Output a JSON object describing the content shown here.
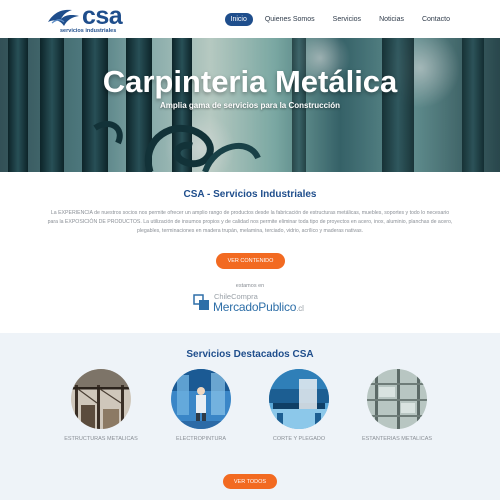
{
  "header": {
    "logo_text": "csa",
    "logo_sub": "servicios industriales",
    "nav": [
      {
        "label": "Inicio",
        "active": true
      },
      {
        "label": "Quienes Somos",
        "active": false
      },
      {
        "label": "Servicios",
        "active": false
      },
      {
        "label": "Noticias",
        "active": false
      },
      {
        "label": "Contacto",
        "active": false
      }
    ]
  },
  "hero": {
    "title": "Carpinteria Metálica",
    "subtitle": "Amplia gama de servicios para la Construcción"
  },
  "about": {
    "title": "CSA - Servicios Industriales",
    "text": "La EXPERIENCIA de nuestros socios nos permite ofrecer un amplio rango de productos desde la fabricación de estructuras metálicas, muebles, soportes y todo lo necesario para la EXPOSICIÓN DE PRODUCTOS. La utilización de insumos propios y de calidad nos permite eliminar toda tipo de proyectos en acero, inox, aluminio, planchas de acero, plegables, terminaciones en madera trupán, melamina, terciado, vidrio, acrílico y maderas nativas.",
    "button_label": "VER CONTENIDO",
    "listed_label": "estamos en",
    "mp_small": "ChileCompra",
    "mp_big": "MercadoPublico",
    "mp_suffix": ".cl"
  },
  "services": {
    "title": "Servicios Destacados CSA",
    "items": [
      {
        "label": "ESTRUCTURAS METALICAS",
        "icon": "steel-structure-photo"
      },
      {
        "label": "ELECTROPINTURA",
        "icon": "electropainting-photo"
      },
      {
        "label": "CORTE Y PLEGADO",
        "icon": "cutting-bending-photo"
      },
      {
        "label": "ESTANTERIAS METALICAS",
        "icon": "metal-shelving-photo"
      }
    ],
    "button_label": "VER TODOS"
  },
  "colors": {
    "brand_blue": "#1f4e8c",
    "accent_orange": "#f26a21",
    "section_bg": "#eef3f8"
  }
}
